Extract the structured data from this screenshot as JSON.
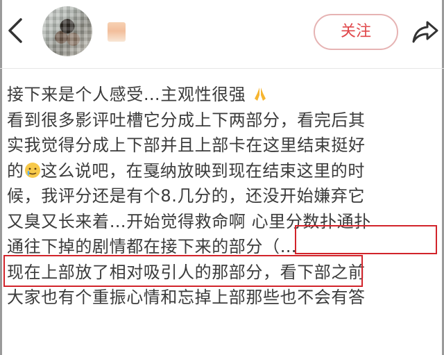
{
  "header": {
    "follow_label": "关注"
  },
  "post": {
    "lines": [
      {
        "text": "接下来是个人感受…主观性很强",
        "emoji": "pray-emoji"
      },
      {
        "text": "看到很多影评吐槽它分成上下两部分，看完后其"
      },
      {
        "text": "实我觉得分成上下部并且上部卡在这里结束挺好"
      },
      {
        "prefix": "的",
        "emoji": "tearful-smile-emoji",
        "text": "这么说吧，在戛纳放映到现在结束这里的时"
      },
      {
        "text": "候，我评分还是有个8.几分的，还没开始嫌弃它"
      },
      {
        "text": "又臭又长来着…开始觉得救命啊 心里分数扑通扑"
      },
      {
        "text": "通往下掉的剧情都在接下来的部分（…"
      },
      {
        "text": "现在上部放了相对吸引人的那部分，看下部之前"
      },
      {
        "text": "大家也有个重振心情和忘掉上部那些也不会有答"
      }
    ]
  },
  "colors": {
    "follow": "#e0474a",
    "highlight_box": "#d2232a"
  }
}
